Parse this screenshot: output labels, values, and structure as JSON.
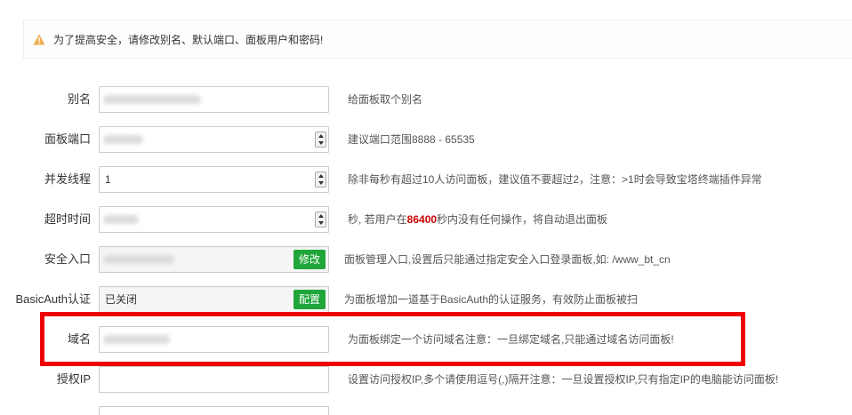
{
  "alert": {
    "icon": "warning-icon",
    "text": "为了提高安全，请修改别名、默认端口、面板用户和密码!"
  },
  "rows": {
    "alias": {
      "label": "别名",
      "value": "",
      "desc": "给面板取个别名"
    },
    "port": {
      "label": "面板端口",
      "value": "",
      "desc": "建议端口范围8888 - 65535"
    },
    "threads": {
      "label": "并发线程",
      "value": "1",
      "desc": "除非每秒有超过10人访问面板，建议值不要超过2，注意：>1时会导致宝塔终端插件异常"
    },
    "timeout": {
      "label": "超时时间",
      "value": "",
      "desc_before": "秒, 若用户在",
      "desc_num": "86400",
      "desc_after": "秒内没有任何操作，将自动退出面板"
    },
    "entry": {
      "label": "安全入口",
      "value": "",
      "button": "修改",
      "desc": "面板管理入口,设置后只能通过指定安全入口登录面板,如: /www_bt_cn"
    },
    "basicauth": {
      "label": "BasicAuth认证",
      "value": "已关闭",
      "button": "配置",
      "desc": "为面板增加一道基于BasicAuth的认证服务，有效防止面板被扫"
    },
    "domain": {
      "label": "域名",
      "value": "",
      "desc": "为面板绑定一个访问域名注意：一旦绑定域名,只能通过域名访问面板!"
    },
    "authip": {
      "label": "授权IP",
      "value": "",
      "desc": "设置访问授权IP,多个请使用逗号(,)隔开注意：一旦设置授权IP,只有指定IP的电脑能访问面板!"
    }
  },
  "colors": {
    "accent_green": "#20a53a",
    "highlight_red": "#ee0000",
    "warning_orange": "#f0ad4e"
  }
}
